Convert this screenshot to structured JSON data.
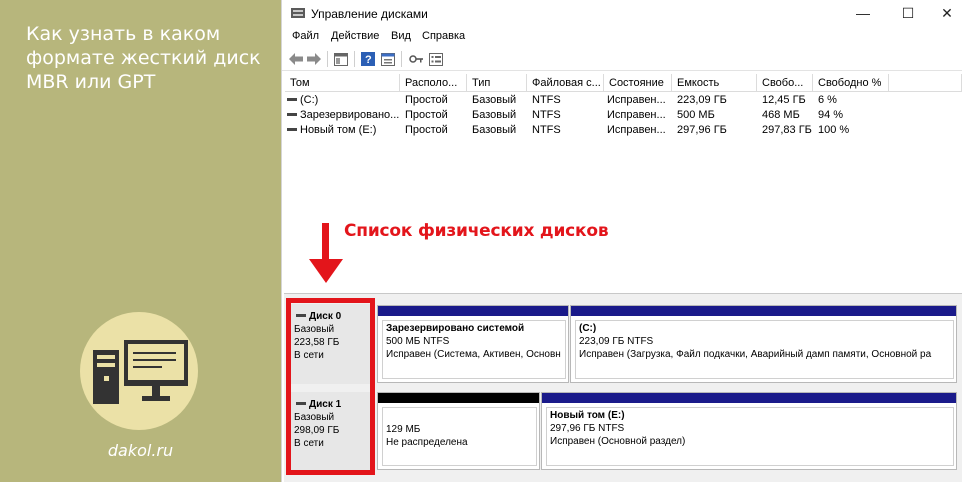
{
  "promo": {
    "title": "Как узнать в каком формате жесткий диск MBR или GPT",
    "site": "dakol.ru"
  },
  "window": {
    "title": "Управление дисками",
    "controls": {
      "minimize": "—",
      "maximize": "☐",
      "close": "✕"
    }
  },
  "menu": [
    "Файл",
    "Действие",
    "Вид",
    "Справка"
  ],
  "volumes": {
    "columns": [
      "Том",
      "Располо...",
      "Тип",
      "Файловая с...",
      "Состояние",
      "Емкость",
      "Свобо...",
      "Свободно %"
    ],
    "rows": [
      [
        "(C:)",
        "Простой",
        "Базовый",
        "NTFS",
        "Исправен...",
        "223,09 ГБ",
        "12,45 ГБ",
        "6 %"
      ],
      [
        "Зарезервировано...",
        "Простой",
        "Базовый",
        "NTFS",
        "Исправен...",
        "500 МБ",
        "468 МБ",
        "94 %"
      ],
      [
        "Новый том (E:)",
        "Простой",
        "Базовый",
        "NTFS",
        "Исправен...",
        "297,96 ГБ",
        "297,83 ГБ",
        "100 %"
      ]
    ]
  },
  "annotation": "Список физических дисков",
  "disks": [
    {
      "name": "Диск 0",
      "type": "Базовый",
      "size": "223,58 ГБ",
      "status": "В сети",
      "partitions": [
        {
          "name": "Зарезервировано системой",
          "size": "500 МБ NTFS",
          "status": "Исправен (Система, Активен, Основн"
        },
        {
          "name": "(C:)",
          "size": "223,09 ГБ NTFS",
          "status": "Исправен (Загрузка, Файл подкачки, Аварийный дамп памяти, Основной ра"
        }
      ]
    },
    {
      "name": "Диск 1",
      "type": "Базовый",
      "size": "298,09 ГБ",
      "status": "В сети",
      "partitions": [
        {
          "name": "",
          "size": "129 МБ",
          "status": "Не распределена"
        },
        {
          "name": "Новый том (E:)",
          "size": "297,96 ГБ NTFS",
          "status": "Исправен (Основной раздел)"
        }
      ]
    }
  ],
  "colors": {
    "promo_bg": "#b7b67c",
    "annotation_red": "#e3151b",
    "primary_bar": "#1a1a8a",
    "unallocated_bar": "#000000"
  }
}
